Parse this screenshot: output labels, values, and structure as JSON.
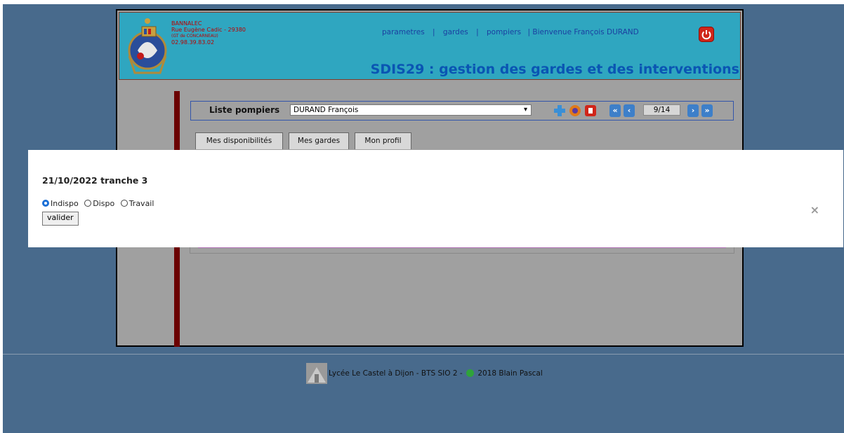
{
  "header": {
    "address": {
      "line1": "BANNALEC",
      "line2": "Rue Eugène Cadic - 29380",
      "line3": "(GT de CONCARNEAU)",
      "line4": "02.98.39.83.02"
    },
    "nav": {
      "parametres": "parametres",
      "gardes": "gardes",
      "pompiers": "pompiers",
      "separator": "|",
      "welcome": "| Bienvenue François DURAND"
    },
    "title": "SDIS29 : gestion des gardes et des interventions"
  },
  "panel": {
    "label": "Liste pompiers",
    "selected_pompier": "DURAND François",
    "page_indicator": "9/14",
    "icons": [
      "add-icon",
      "logo-icon",
      "delete-icon"
    ],
    "nav": [
      "first",
      "previous",
      "next",
      "last"
    ]
  },
  "tabs": [
    "Mes disponibilités",
    "Mes gardes",
    "Mon profil"
  ],
  "modal": {
    "title": "21/10/2022 tranche 3",
    "options": [
      "Indispo",
      "Dispo",
      "Travail"
    ],
    "selected": "Indispo",
    "submit_label": "valider",
    "close_label": "×"
  },
  "footer": {
    "text": "Lycée Le Castel à Dijon - BTS SIO 2 -",
    "year_author": "2018 Blain Pascal"
  },
  "colors": {
    "page_bg": "#486a8c",
    "header_bg": "#2fa6c0",
    "title": "#0a55b3",
    "address": "#b90000",
    "leftbar": "#6b0000"
  }
}
